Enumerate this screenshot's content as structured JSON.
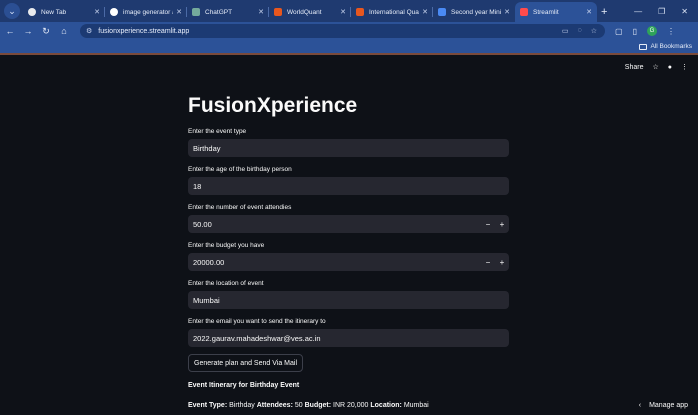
{
  "browser": {
    "tabs": [
      {
        "label": "New Tab",
        "favicon": "chrome-icon",
        "color": "#e8eaed"
      },
      {
        "label": "image generator ai c",
        "favicon": "google-icon",
        "color": "#ffffff"
      },
      {
        "label": "ChatGPT",
        "favicon": "chatgpt-icon",
        "color": "#74aa9c"
      },
      {
        "label": "WorldQuant",
        "favicon": "worldquant-icon",
        "color": "#e8571e"
      },
      {
        "label": "International Quant C",
        "favicon": "worldquant-icon",
        "color": "#e8571e"
      },
      {
        "label": "Second year Mini Pr",
        "favicon": "docs-icon",
        "color": "#4a8af4"
      },
      {
        "label": "Streamlit",
        "favicon": "streamlit-icon",
        "color": "#ff4b4b"
      }
    ],
    "url": "fusionxperience.streamlit.app",
    "bookmarks_label": "All Bookmarks",
    "profile_initial": "G"
  },
  "header": {
    "share_label": "Share"
  },
  "app": {
    "title": "FusionXperience",
    "fields": {
      "event_type": {
        "label": "Enter the event type",
        "value": "Birthday"
      },
      "age": {
        "label": "Enter the age of the birthday person",
        "value": "18"
      },
      "attendees": {
        "label": "Enter the number of event attendies",
        "value": "50.00",
        "minus": "−",
        "plus": "+"
      },
      "budget": {
        "label": "Enter the budget you have",
        "value": "20000.00",
        "minus": "−",
        "plus": "+"
      },
      "location": {
        "label": "Enter the location of event",
        "value": "Mumbai"
      },
      "email": {
        "label": "Enter the email you want to send the itinerary to",
        "value": "2022.gaurav.mahadeshwar@ves.ac.in"
      }
    },
    "button_label": "Generate plan and Send Via Mail",
    "itinerary_heading": "Event Itinerary for Birthday Event",
    "itinerary": {
      "type_label": "Event Type:",
      "type_value": " Birthday ",
      "attendees_label": "Attendees:",
      "attendees_value": " 50 ",
      "budget_label": "Budget:",
      "budget_value": " INR 20,000 ",
      "location_label": "Location:",
      "location_value": " Mumbai"
    },
    "manage_label": "Manage app"
  }
}
